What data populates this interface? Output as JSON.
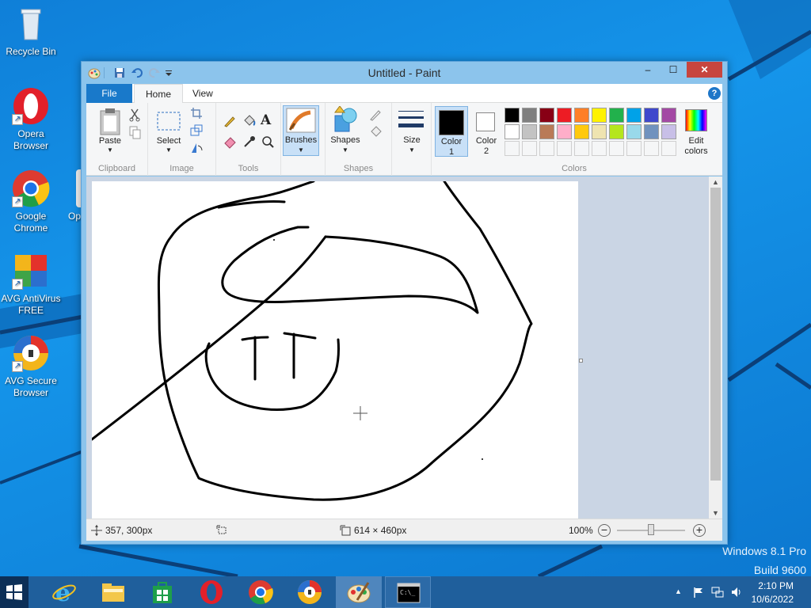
{
  "desktop": {
    "icons": [
      {
        "label": "Recycle Bin",
        "icon": "recycle-bin-icon"
      },
      {
        "label": "Opera Browser",
        "icon": "opera-icon"
      },
      {
        "label": "Google Chrome",
        "icon": "chrome-icon"
      },
      {
        "label": "AVG AntiVirus FREE",
        "icon": "avg-antivirus-icon"
      },
      {
        "label": "AVG Secure Browser",
        "icon": "avg-secure-browser-icon"
      },
      {
        "label": "Op",
        "icon": "partial-icon"
      }
    ],
    "watermark_line1": "Windows 8.1 Pro",
    "watermark_line2": "Build 9600"
  },
  "window": {
    "title": "Untitled - Paint",
    "controls": {
      "minimize": "–",
      "maximize": "☐",
      "close": "✕"
    }
  },
  "ribbon": {
    "tabs": {
      "file": "File",
      "home": "Home",
      "view": "View"
    },
    "groups": {
      "clipboard": {
        "label": "Clipboard",
        "paste": "Paste"
      },
      "image": {
        "label": "Image",
        "select": "Select"
      },
      "tools": {
        "label": "Tools"
      },
      "brushes": {
        "label": "Brushes"
      },
      "shapes": {
        "label": "Shapes",
        "button": "Shapes"
      },
      "size": {
        "label": "Size"
      },
      "colors": {
        "label": "Colors",
        "color1": "Color\n1",
        "color2": "Color\n2",
        "edit": "Edit\ncolors"
      }
    },
    "palette_row1": [
      "#000000",
      "#7f7f7f",
      "#880015",
      "#ed1c24",
      "#ff7f27",
      "#fff200",
      "#22b14c",
      "#00a2e8",
      "#3f48cc",
      "#a349a4"
    ],
    "palette_row2": [
      "#ffffff",
      "#c3c3c3",
      "#b97a57",
      "#ffaec9",
      "#ffc90e",
      "#efe4b0",
      "#b5e61d",
      "#99d9ea",
      "#7092be",
      "#c8bfe7"
    ],
    "palette_row3": [
      "#f5f6f7",
      "#f5f6f7",
      "#f5f6f7",
      "#f5f6f7",
      "#f5f6f7",
      "#f5f6f7",
      "#f5f6f7",
      "#f5f6f7",
      "#f5f6f7",
      "#f5f6f7"
    ]
  },
  "status": {
    "cursor_pos": "357, 300px",
    "canvas_size": "614 × 460px",
    "zoom": "100%"
  },
  "taskbar": {
    "apps": [
      "internet-explorer-icon",
      "file-explorer-icon",
      "store-icon",
      "opera-icon",
      "chrome-icon",
      "avg-secure-browser-icon",
      "paint-icon",
      "cmd-icon"
    ],
    "time": "2:10 PM",
    "date": "10/6/2022"
  }
}
